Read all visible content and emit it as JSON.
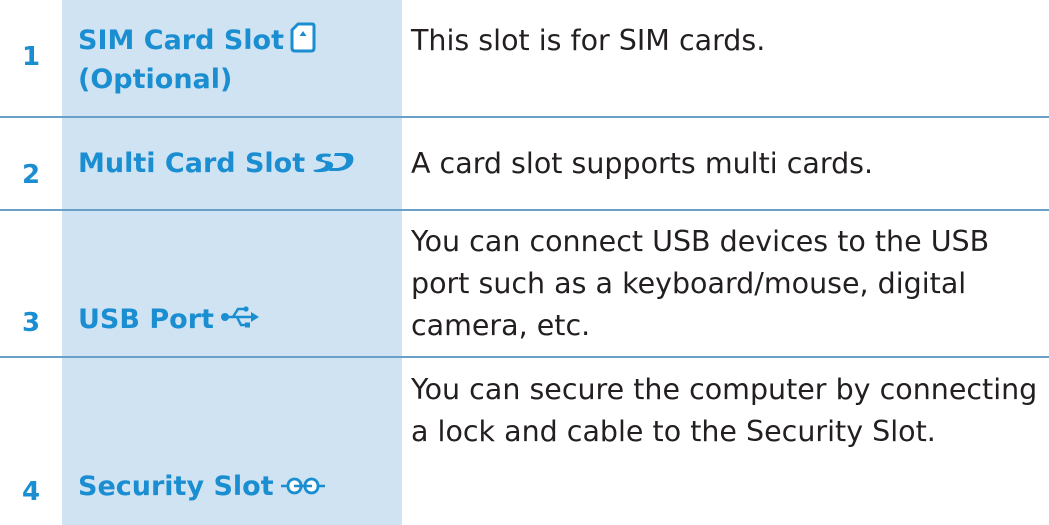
{
  "colors": {
    "accent": "#1a8ed1",
    "name_column_bg": "#cfe3f3",
    "divider": "#6a9fc7",
    "body_text": "#231f20"
  },
  "rows": [
    {
      "number": "1",
      "name_line1": "SIM Card Slot",
      "name_line2": "(Optional)",
      "icon": "sim-card-icon",
      "description": "This slot is for SIM cards."
    },
    {
      "number": "2",
      "name_line1": "Multi Card Slot",
      "icon": "sd-card-icon",
      "description": "A card slot supports multi cards."
    },
    {
      "number": "3",
      "name_line1": "USB Port",
      "icon": "usb-icon",
      "description": "You can connect USB devices to the USB port such as a keyboard/mouse, digital camera, etc."
    },
    {
      "number": "4",
      "name_line1": "Security Slot",
      "icon": "security-lock-icon",
      "description": "You can secure the computer by connecting a lock and cable to the Security Slot."
    }
  ]
}
